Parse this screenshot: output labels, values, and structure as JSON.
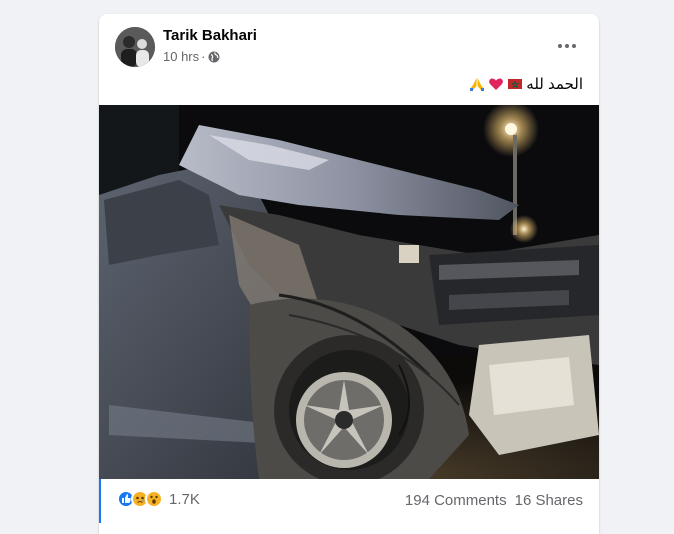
{
  "post": {
    "author": "Tarik Bakhari",
    "time": "10 hrs",
    "separator": "·",
    "caption": "الحمد لله",
    "caption_emojis": [
      "flag-icon",
      "heart-icon",
      "pray-icon"
    ],
    "photo_alt": "wrecked-car-photo",
    "reaction_types": [
      "like-icon",
      "sad-icon",
      "wow-icon"
    ],
    "reaction_count": "1.7K",
    "comments": "194 Comments",
    "shares": "16 Shares"
  },
  "colors": {
    "accent": "#1877f2",
    "secondary_text": "#65676b",
    "background": "#f0f2f5"
  }
}
